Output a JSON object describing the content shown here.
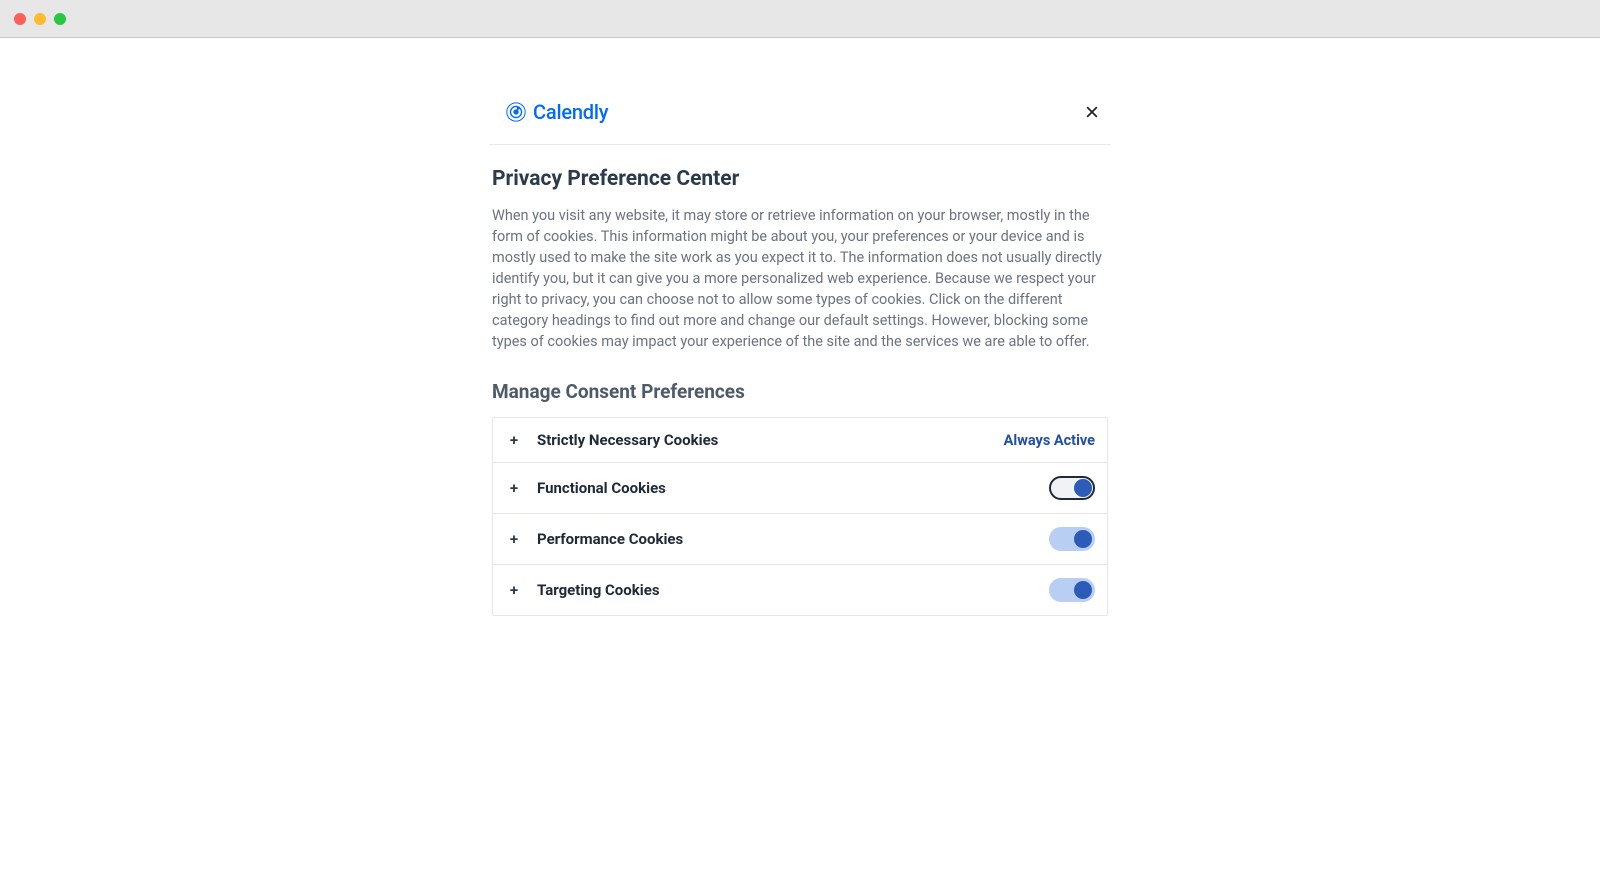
{
  "brand": {
    "name": "Calendly"
  },
  "modal": {
    "title": "Privacy Preference Center",
    "description": "When you visit any website, it may store or retrieve information on your browser, mostly in the form of cookies. This information might be about you, your preferences or your device and is mostly used to make the site work as you expect it to. The information does not usually directly identify you, but it can give you a more personalized web experience. Because we respect your right to privacy, you can choose not to allow some types of cookies. Click on the different category headings to find out more and change our default settings. However, blocking some types of cookies may impact your experience of the site and the services we are able to offer.",
    "manage_heading": "Manage Consent Preferences",
    "always_active_label": "Always Active",
    "categories": [
      {
        "label": "Strictly Necessary Cookies",
        "status": "always_active"
      },
      {
        "label": "Functional Cookies",
        "status": "toggle",
        "enabled": true,
        "toggle_style": "outline"
      },
      {
        "label": "Performance Cookies",
        "status": "toggle",
        "enabled": true,
        "toggle_style": "light"
      },
      {
        "label": "Targeting Cookies",
        "status": "toggle",
        "enabled": true,
        "toggle_style": "light"
      }
    ]
  }
}
